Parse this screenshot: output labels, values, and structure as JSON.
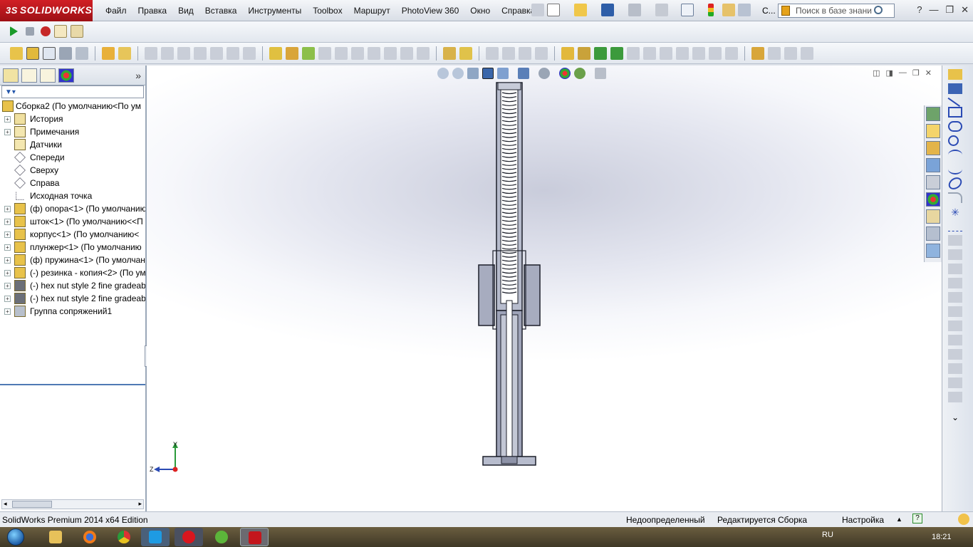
{
  "app": {
    "logo_prefix": "3S",
    "logo_text": "SOLIDWORKS"
  },
  "menu": [
    "Файл",
    "Правка",
    "Вид",
    "Вставка",
    "Инструменты",
    "Toolbox",
    "Маршрут",
    "PhotoView 360",
    "Окно",
    "Справка"
  ],
  "titlebar": {
    "search_placeholder": "Поиск в базе знани",
    "abbrev_label": "С..."
  },
  "tree": {
    "root": "Сборка2  (По умолчанию<По ум",
    "items": [
      {
        "label": "История",
        "icon": "history-icon",
        "expandable": true
      },
      {
        "label": "Примечания",
        "icon": "annotations-icon",
        "expandable": true
      },
      {
        "label": "Датчики",
        "icon": "sensors-icon",
        "expandable": false
      },
      {
        "label": "Спереди",
        "icon": "plane-icon",
        "expandable": false
      },
      {
        "label": "Сверху",
        "icon": "plane-icon",
        "expandable": false
      },
      {
        "label": "Справа",
        "icon": "plane-icon",
        "expandable": false
      },
      {
        "label": "Исходная точка",
        "icon": "origin-icon",
        "expandable": false
      },
      {
        "label": "(ф) опора<1> (По умолчанию",
        "icon": "part-icon",
        "expandable": true
      },
      {
        "label": "шток<1> (По умолчанию<<П",
        "icon": "part-icon",
        "expandable": true
      },
      {
        "label": "корпус<1> (По умолчанию<",
        "icon": "part-icon",
        "expandable": true
      },
      {
        "label": "плунжер<1> (По умолчанию",
        "icon": "part-icon",
        "expandable": true
      },
      {
        "label": "(ф) пружина<1> (По умолчан",
        "icon": "part-icon",
        "expandable": true
      },
      {
        "label": "(-) резинка - копия<2> (По ум",
        "icon": "part-icon",
        "expandable": true
      },
      {
        "label": "(-) hex nut style 2 fine gradeab",
        "icon": "toolbox-part-icon",
        "expandable": true
      },
      {
        "label": "(-) hex nut style 2 fine gradeab",
        "icon": "toolbox-part-icon",
        "expandable": true
      },
      {
        "label": "Группа сопряжений1",
        "icon": "mates-icon",
        "expandable": true
      }
    ]
  },
  "triad": {
    "y_label": "Y",
    "z_label": "Z"
  },
  "status": {
    "edition": "SolidWorks Premium 2014 x64 Edition",
    "state": "Недоопределенный",
    "editing": "Редактируется Сборка",
    "custom": "Настройка"
  },
  "taskbar": {
    "lang": "RU",
    "time": "18:21",
    "apps": [
      "explorer-icon",
      "firefox-icon",
      "chrome-icon",
      "skype-icon",
      "opera-icon",
      "utorrent-icon",
      "solidworks-icon"
    ]
  },
  "colors": {
    "accent_red": "#c4161c",
    "selection_blue": "#4f79b4",
    "model_steel": "#8e93a8"
  }
}
